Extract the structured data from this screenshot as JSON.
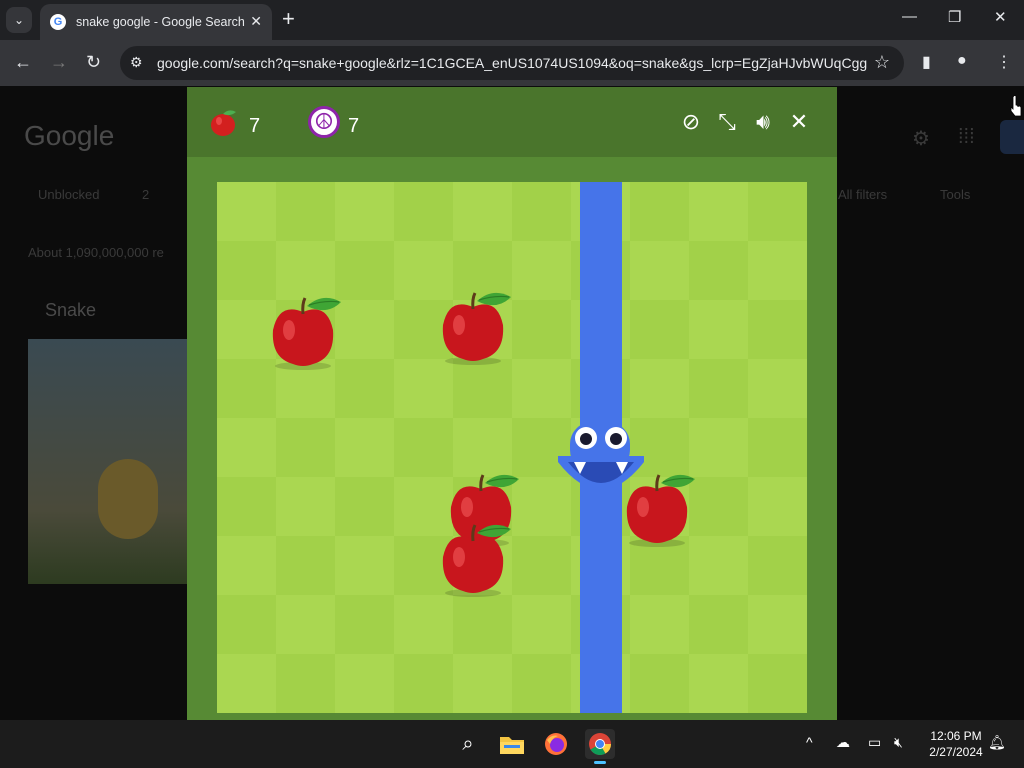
{
  "browser": {
    "tab_title": "snake google - Google Search",
    "url": "google.com/search?q=snake+google&rlz=1C1GCEA_enUS1074US1094&oq=snake&gs_lcrp=EgZjaHJvbWUqCgg..."
  },
  "page": {
    "logo": "Google",
    "filter_unblocked": "Unblocked",
    "filter_count": "2",
    "all_filters": "All filters",
    "tools": "Tools",
    "result_stats": "About 1,090,000,000 re",
    "side_title": "Snake"
  },
  "game": {
    "score": "7",
    "best_score": "7",
    "grid": {
      "columns": 10,
      "rows": 9
    },
    "snake_column": 7,
    "apples_visible": 5
  },
  "taskbar": {
    "time": "12:06 PM",
    "date": "2/27/2024"
  },
  "colors": {
    "board_light": "#aad751",
    "board_dark": "#a2d149",
    "header": "#4a752c",
    "border": "#578a34",
    "snake": "#4674e9"
  }
}
